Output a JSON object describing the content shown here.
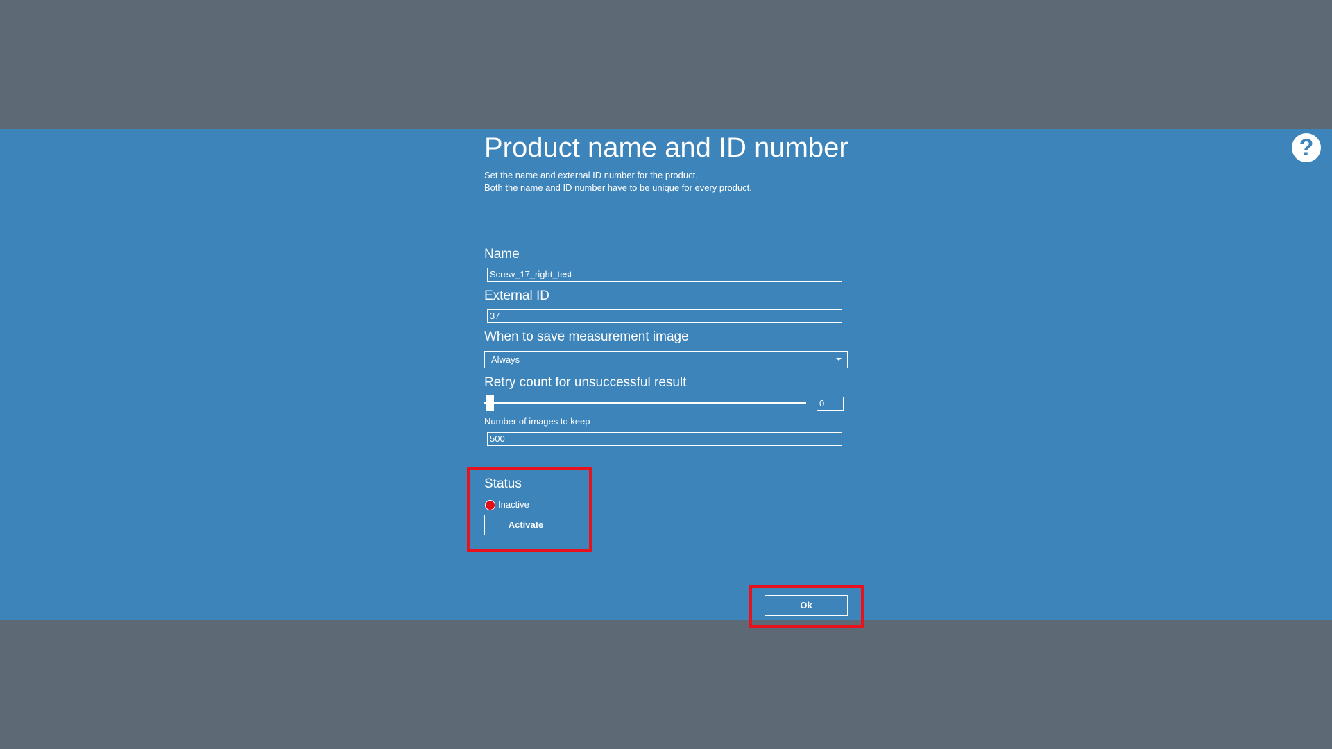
{
  "page": {
    "title": "Product name and ID number",
    "description_line1": "Set the name and external ID number for the product.",
    "description_line2": "Both the name and ID number have to be unique for every product.",
    "help_symbol": "?"
  },
  "form": {
    "name_label": "Name",
    "name_value": "Screw_17_right_test",
    "external_id_label": "External ID",
    "external_id_value": "37",
    "save_image_label": "When to save measurement image",
    "save_image_value": "Always",
    "retry_label": "Retry count for unsuccessful result",
    "retry_value": "0",
    "images_keep_label": "Number of images to keep",
    "images_keep_value": "500"
  },
  "status": {
    "label": "Status",
    "state": "Inactive",
    "state_color": "#e0101a",
    "activate_label": "Activate"
  },
  "actions": {
    "ok_label": "Ok"
  },
  "colors": {
    "backdrop": "#5d6a75",
    "panel": "#3d84bb",
    "highlight": "#e8111c"
  }
}
